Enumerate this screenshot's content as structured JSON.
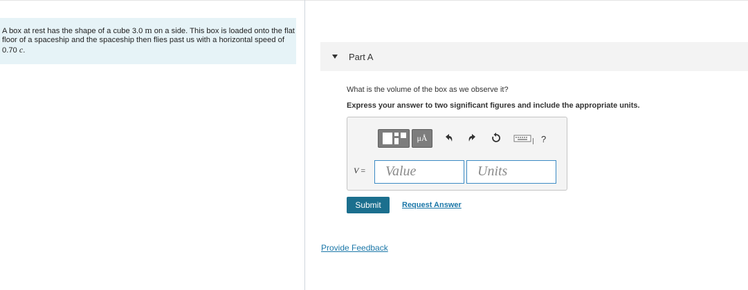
{
  "problem": {
    "text_1": "A box at rest has the shape of a cube 3.0 ",
    "unit": "m",
    "text_2": " on a side. This box is loaded onto the flat floor of a spaceship and the spaceship then flies past us with a horizontal speed of 0.70 ",
    "speed_var": "c",
    "text_3": "."
  },
  "part": {
    "title": "Part A",
    "question": "What is the volume of the box as we observe it?",
    "instruction": "Express your answer to two significant figures and include the appropriate units."
  },
  "toolbar": {
    "units_label": "μÅ",
    "help_label": "?",
    "icons": [
      "templates-icon",
      "units-icon",
      "undo-icon",
      "redo-icon",
      "reset-icon",
      "keyboard-icon",
      "help-icon"
    ]
  },
  "answer": {
    "variable": "V",
    "equals": "=",
    "value_placeholder": "Value",
    "units_placeholder": "Units"
  },
  "actions": {
    "submit_label": "Submit",
    "request_label": "Request Answer",
    "feedback_label": "Provide Feedback"
  },
  "colors": {
    "problem_bg": "#e6f3f7",
    "submit_bg": "#1b6f8e",
    "link": "#1b77a8",
    "field_border": "#3b8ac4"
  }
}
